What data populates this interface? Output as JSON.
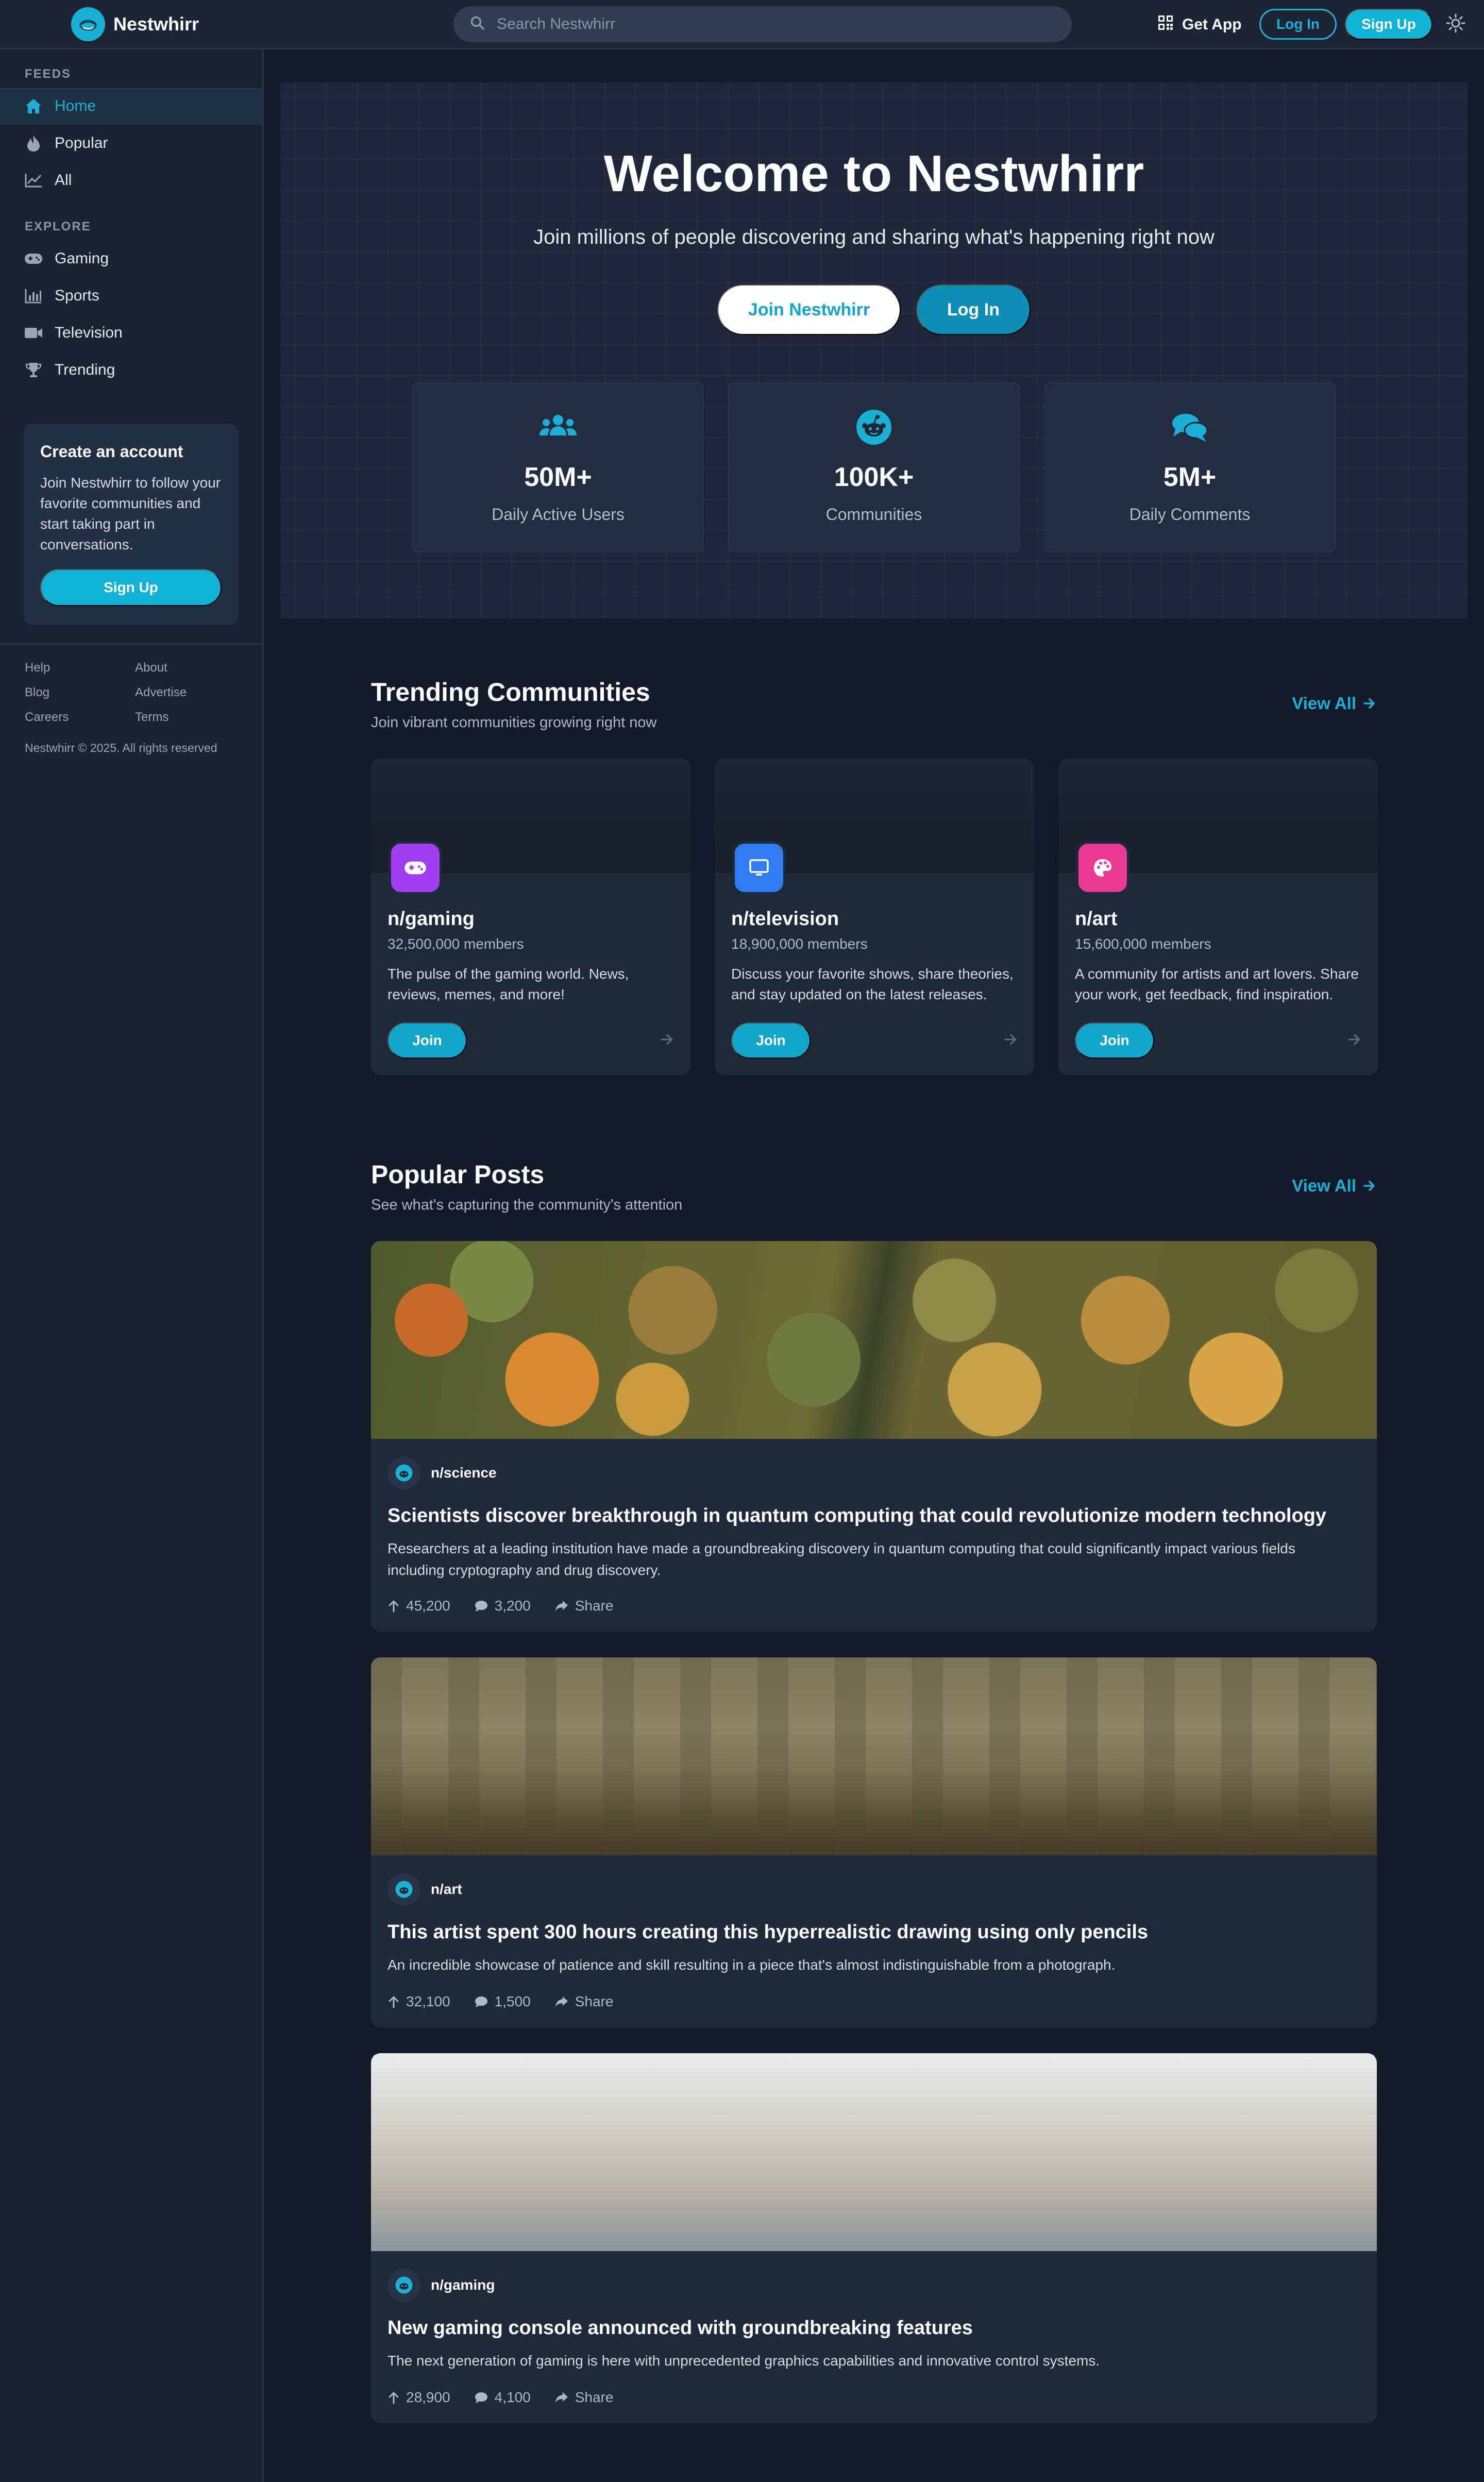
{
  "header": {
    "brand_name": "Nestwhirr",
    "search_placeholder": "Search Nestwhirr",
    "get_app_label": "Get App",
    "login_label": "Log In",
    "signup_label": "Sign Up",
    "accent_color": "#1ab0d6"
  },
  "sidebar": {
    "feeds_heading": "FEEDS",
    "feeds": [
      {
        "label": "Home",
        "icon": "home-icon",
        "active": true
      },
      {
        "label": "Popular",
        "icon": "flame-icon"
      },
      {
        "label": "All",
        "icon": "chart-line-icon"
      }
    ],
    "explore_heading": "EXPLORE",
    "explore": [
      {
        "label": "Gaming",
        "icon": "gamepad-icon"
      },
      {
        "label": "Sports",
        "icon": "bar-chart-icon"
      },
      {
        "label": "Television",
        "icon": "video-camera-icon"
      },
      {
        "label": "Trending",
        "icon": "trophy-icon"
      }
    ],
    "account_card": {
      "title": "Create an account",
      "text": "Join Nestwhirr to follow your favorite communities and start taking part in conversations.",
      "button": "Sign Up"
    },
    "footer_links": [
      "Help",
      "About",
      "Blog",
      "Advertise",
      "Careers",
      "Terms"
    ],
    "copyright": "Nestwhirr © 2025. All rights reserved"
  },
  "hero": {
    "title": "Welcome to Nestwhirr",
    "subtitle": "Join millions of people discovering and sharing what's happening right now",
    "join_button": "Join Nestwhirr",
    "login_button": "Log In",
    "stats": [
      {
        "value": "50M+",
        "label": "Daily Active Users",
        "icon": "users-icon"
      },
      {
        "value": "100K+",
        "label": "Communities",
        "icon": "robot-face-icon"
      },
      {
        "value": "5M+",
        "label": "Daily Comments",
        "icon": "comments-icon"
      }
    ]
  },
  "trending": {
    "title": "Trending Communities",
    "subtitle": "Join vibrant communities growing right now",
    "view_all": "View All",
    "communities": [
      {
        "name": "n/gaming",
        "members": "32,500,000 members",
        "description": "The pulse of the gaming world. News, reviews, memes, and more!",
        "join": "Join",
        "icon": "gamepad-icon",
        "color": "#a33df0"
      },
      {
        "name": "n/television",
        "members": "18,900,000 members",
        "description": "Discuss your favorite shows, share theories, and stay updated on the latest releases.",
        "join": "Join",
        "icon": "monitor-icon",
        "color": "#2f7cf0"
      },
      {
        "name": "n/art",
        "members": "15,600,000 members",
        "description": "A community for artists and art lovers. Share your work, get feedback, find inspiration.",
        "join": "Join",
        "icon": "palette-icon",
        "color": "#ea3a96"
      }
    ]
  },
  "popular": {
    "title": "Popular Posts",
    "subtitle": "See what's capturing the community's attention",
    "view_all": "View All",
    "posts": [
      {
        "community": "n/science",
        "title": "Scientists discover breakthrough in quantum computing that could revolutionize modern technology",
        "body": "Researchers at a leading institution have made a groundbreaking discovery in quantum computing that could significantly impact various fields including cryptography and drug discovery.",
        "upvotes": "45,200",
        "comments": "3,200",
        "share": "Share"
      },
      {
        "community": "n/art",
        "title": "This artist spent 300 hours creating this hyperrealistic drawing using only pencils",
        "body": "An incredible showcase of patience and skill resulting in a piece that's almost indistinguishable from a photograph.",
        "upvotes": "32,100",
        "comments": "1,500",
        "share": "Share"
      },
      {
        "community": "n/gaming",
        "title": "New gaming console announced with groundbreaking features",
        "body": "The next generation of gaming is here with unprecedented graphics capabilities and innovative control systems.",
        "upvotes": "28,900",
        "comments": "4,100",
        "share": "Share"
      }
    ]
  }
}
